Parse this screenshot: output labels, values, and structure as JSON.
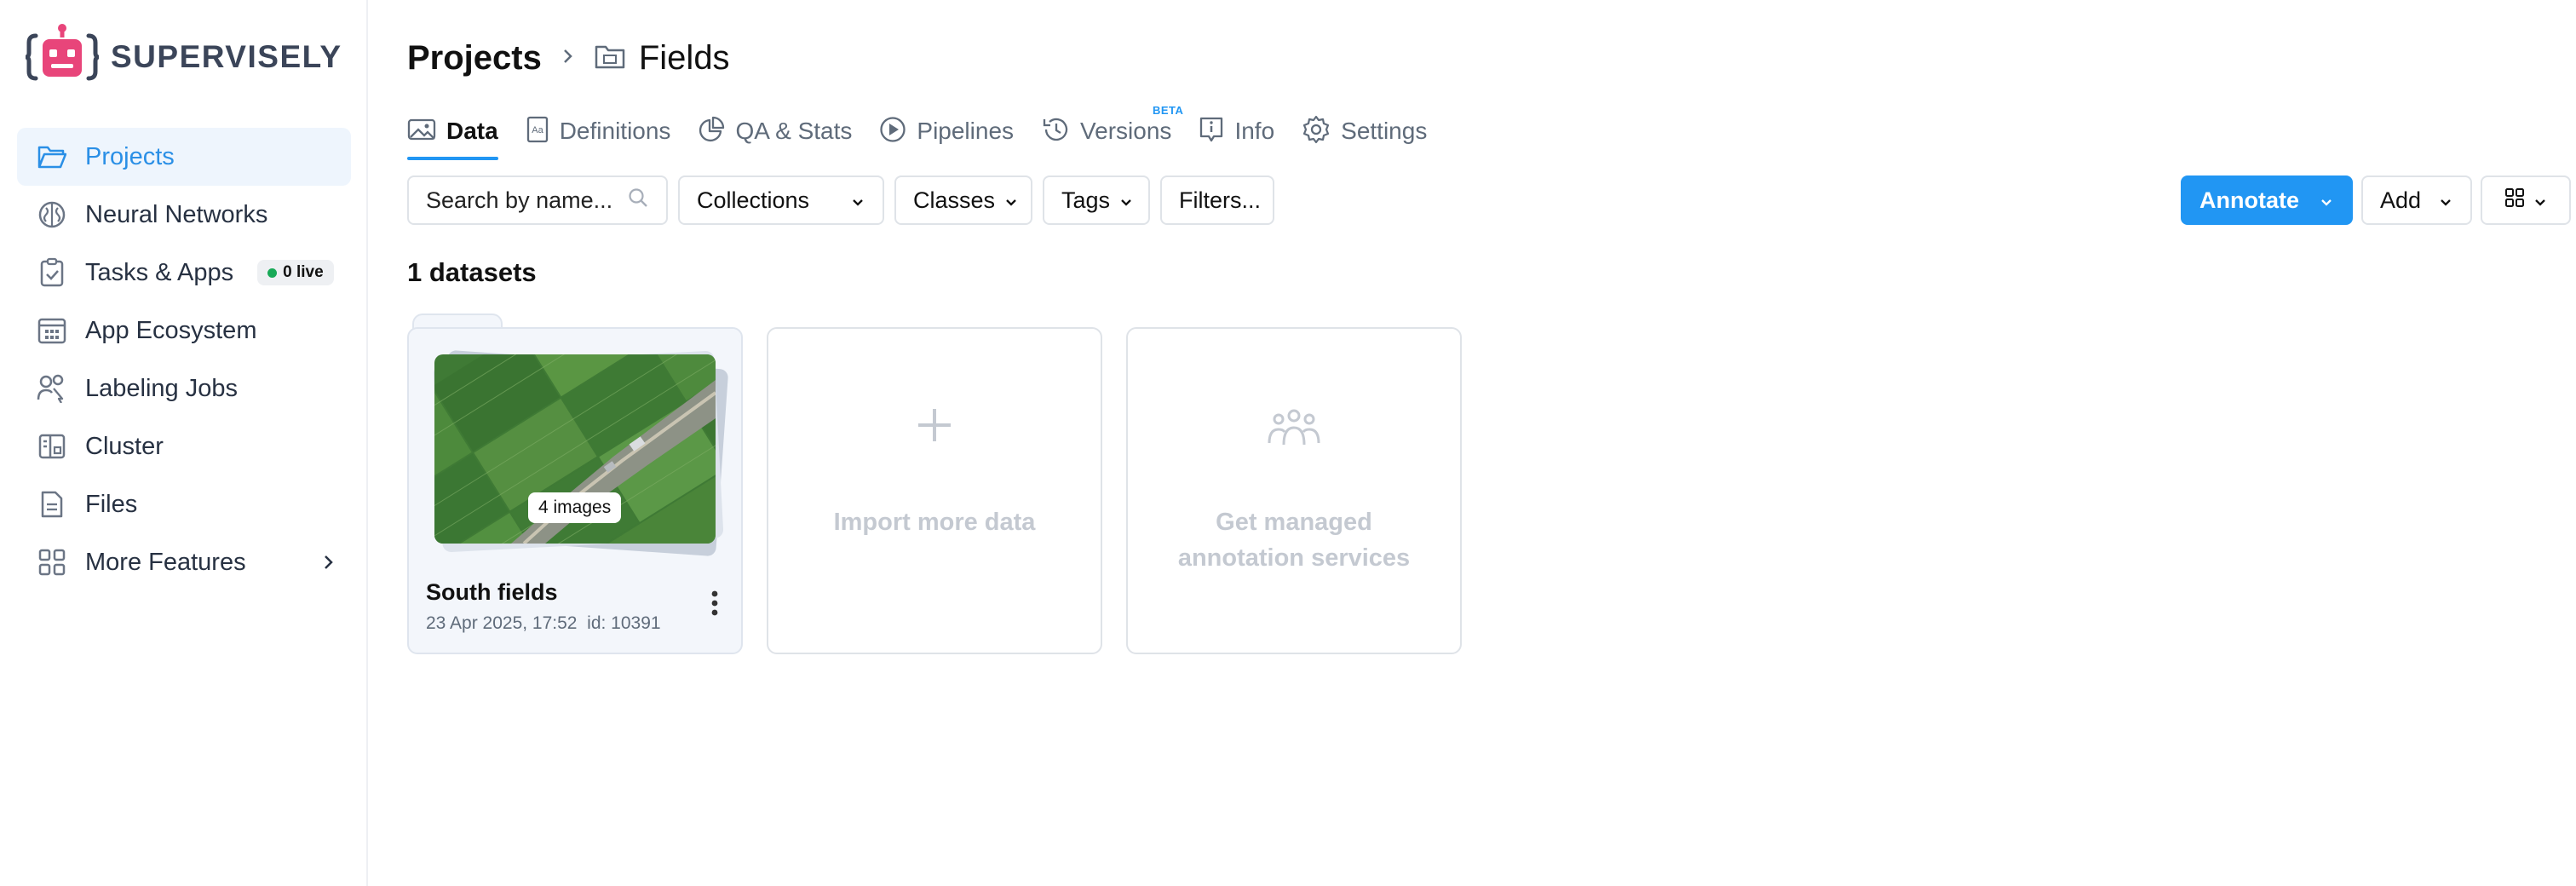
{
  "app": {
    "logo_text": "SUPERVISELY"
  },
  "sidebar": {
    "items": [
      {
        "label": "Projects",
        "icon": "folder-open-icon",
        "active": true
      },
      {
        "label": "Neural Networks",
        "icon": "brain-icon"
      },
      {
        "label": "Tasks & Apps",
        "icon": "clipboard-check-icon",
        "badge": "0 live"
      },
      {
        "label": "App Ecosystem",
        "icon": "calendar-grid-icon"
      },
      {
        "label": "Labeling Jobs",
        "icon": "users-cursor-icon"
      },
      {
        "label": "Cluster",
        "icon": "server-icon"
      },
      {
        "label": "Files",
        "icon": "file-icon"
      },
      {
        "label": "More Features",
        "icon": "grid-icon"
      }
    ]
  },
  "breadcrumb": {
    "root": "Projects",
    "current": "Fields"
  },
  "tabs": [
    {
      "label": "Data",
      "icon": "image-icon",
      "active": true
    },
    {
      "label": "Definitions",
      "icon": "definitions-icon"
    },
    {
      "label": "QA & Stats",
      "icon": "pie-chart-icon"
    },
    {
      "label": "Pipelines",
      "icon": "play-circle-icon"
    },
    {
      "label": "Versions",
      "icon": "history-icon",
      "badge": "BETA"
    },
    {
      "label": "Info",
      "icon": "info-icon"
    },
    {
      "label": "Settings",
      "icon": "gear-icon"
    }
  ],
  "toolbar": {
    "search_placeholder": "Search by name...",
    "collections": "Collections",
    "classes": "Classes",
    "tags": "Tags",
    "filters": "Filters...",
    "annotate": "Annotate",
    "add": "Add"
  },
  "datasets": {
    "count_label": "1 datasets",
    "items": [
      {
        "name": "South fields",
        "date": "23 Apr 2025, 17:52",
        "id": "id: 10391",
        "images": "4 images"
      }
    ]
  },
  "cards": {
    "import": "Import more data",
    "managed_line1": "Get managed",
    "managed_line2": "annotation services"
  },
  "colors": {
    "accent": "#2196f3",
    "logo_pink": "#e8457a",
    "live": "#18a957"
  }
}
